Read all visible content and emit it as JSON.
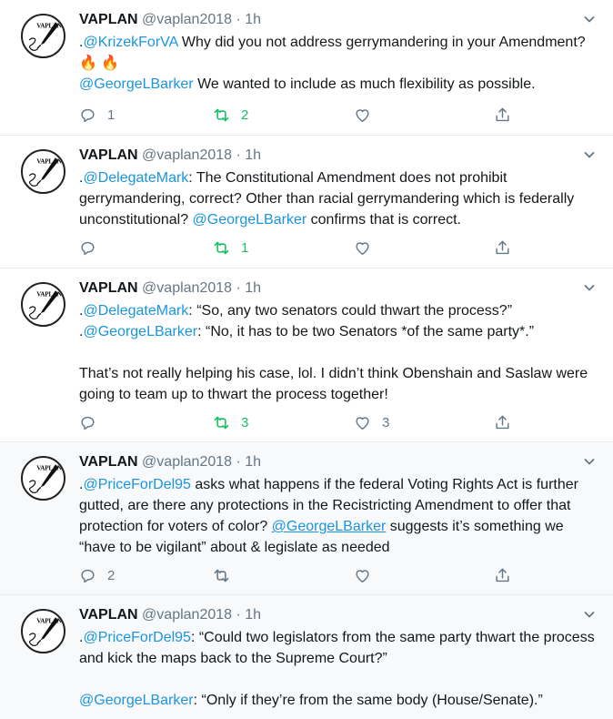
{
  "colors": {
    "link": "#1b95e0",
    "retweet_active": "#17bf63",
    "muted": "#657786",
    "divider": "#e6ecf0"
  },
  "icons": {
    "reply": "reply-icon",
    "retweet": "retweet-icon",
    "like": "heart-icon",
    "share": "share-icon",
    "menu": "chevron-down-icon",
    "avatar": "fountain-pen-logo"
  },
  "avatar_logo_text": "VAPLAN",
  "tweets": [
    {
      "name": "VAPLAN",
      "handle": "@vaplan2018",
      "dot": "·",
      "time": "1h",
      "lines": [
        {
          "prefix": ".",
          "mention": "@KrizekForVA",
          "text": " Why did you not address gerrymandering in your Amendment? 🔥 🔥"
        },
        {
          "prefix": "",
          "mention": "@GeorgeLBarker",
          "text": " We wanted to include as much flexibility as possible."
        }
      ],
      "reply_count": "1",
      "retweet_count": "2",
      "like_count": "",
      "retweet_active": true
    },
    {
      "name": "VAPLAN",
      "handle": "@vaplan2018",
      "dot": "·",
      "time": "1h",
      "lines": [
        {
          "prefix": ".",
          "mention": "@DelegateMark",
          "text": ": The Constitutional Amendment does not prohibit gerrymandering, correct? Other than racial gerrymandering which is federally unconstitutional? ",
          "mention2": "@GeorgeLBarker",
          "text2": " confirms that is correct."
        }
      ],
      "reply_count": "",
      "retweet_count": "1",
      "like_count": "",
      "retweet_active": true
    },
    {
      "name": "VAPLAN",
      "handle": "@vaplan2018",
      "dot": "·",
      "time": "1h",
      "lines": [
        {
          "prefix": ".",
          "mention": "@DelegateMark",
          "text": ": “So, any two senators could thwart the process?”"
        },
        {
          "prefix": ".",
          "mention": "@GeorgeLBarker",
          "text": ": “No, it has to be two Senators *of the same party*.”"
        },
        {
          "prefix": "",
          "mention": "",
          "text": "That’s not really helping his case, lol. I didn’t think Obenshain and Saslaw were going to team up to thwart the process together!",
          "gap": true
        }
      ],
      "reply_count": "",
      "retweet_count": "3",
      "like_count": "3",
      "retweet_active": true
    },
    {
      "name": "VAPLAN",
      "handle": "@vaplan2018",
      "dot": "·",
      "time": "1h",
      "lines": [
        {
          "prefix": ".",
          "mention": "@PriceForDel95",
          "text": " asks what happens if the federal Voting Rights Act is further gutted, are there any protections in the Recistricting Amendment to offer that protection for voters of color? ",
          "mention2": "@GeorgeLBarker",
          "text2": " suggests it’s something we “have to be vigilant” about & legislate as needed"
        }
      ],
      "reply_count": "2",
      "retweet_count": "",
      "like_count": "",
      "retweet_active": false
    },
    {
      "name": "VAPLAN",
      "handle": "@vaplan2018",
      "dot": "·",
      "time": "1h",
      "lines": [
        {
          "prefix": ".",
          "mention": "@PriceForDel95",
          "text": ": “Could two legislators from the same party thwart the process and kick the maps back to the Supreme Court?”"
        },
        {
          "prefix": "",
          "mention": "@GeorgeLBarker",
          "text": ": “Only if they’re from the same body (House/Senate).”",
          "gap": true
        }
      ],
      "reply_count": "",
      "retweet_count": "",
      "like_count": "",
      "retweet_active": false
    }
  ]
}
